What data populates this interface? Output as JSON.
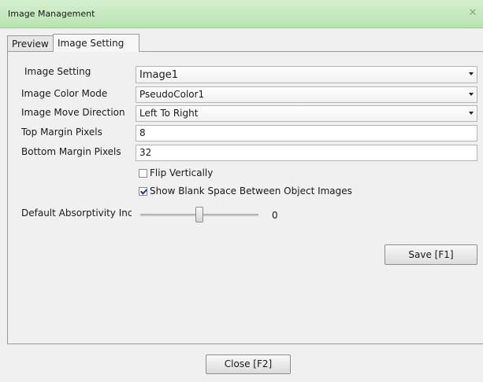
{
  "window": {
    "title": "Image Management",
    "close_glyph": "✕"
  },
  "tabs": [
    {
      "label": "Preview",
      "active": false
    },
    {
      "label": "Image Setting",
      "active": true
    }
  ],
  "form": {
    "image_setting": {
      "label": "Image Setting",
      "value": "Image1"
    },
    "color_mode": {
      "label": "Image Color Mode",
      "value": "PseudoColor1"
    },
    "move_direction": {
      "label": "Image Move Direction",
      "value": "Left To Right"
    },
    "top_margin": {
      "label": "Top Margin Pixels",
      "value": "8"
    },
    "bottom_margin": {
      "label": "Bottom Margin Pixels",
      "value": "32"
    },
    "flip_vertically": {
      "label": "Flip Vertically",
      "checked": false
    },
    "show_blank_space": {
      "label": "Show Blank Space Between Object Images",
      "checked": true
    },
    "absorptivity": {
      "label": "Default Absorptivity Inc",
      "value": "0"
    }
  },
  "buttons": {
    "save": "Save [F1]",
    "close": "Close [F2]"
  },
  "colors": {
    "titlebar": "#c4e9be",
    "accent_check": "#1f3c8c"
  }
}
